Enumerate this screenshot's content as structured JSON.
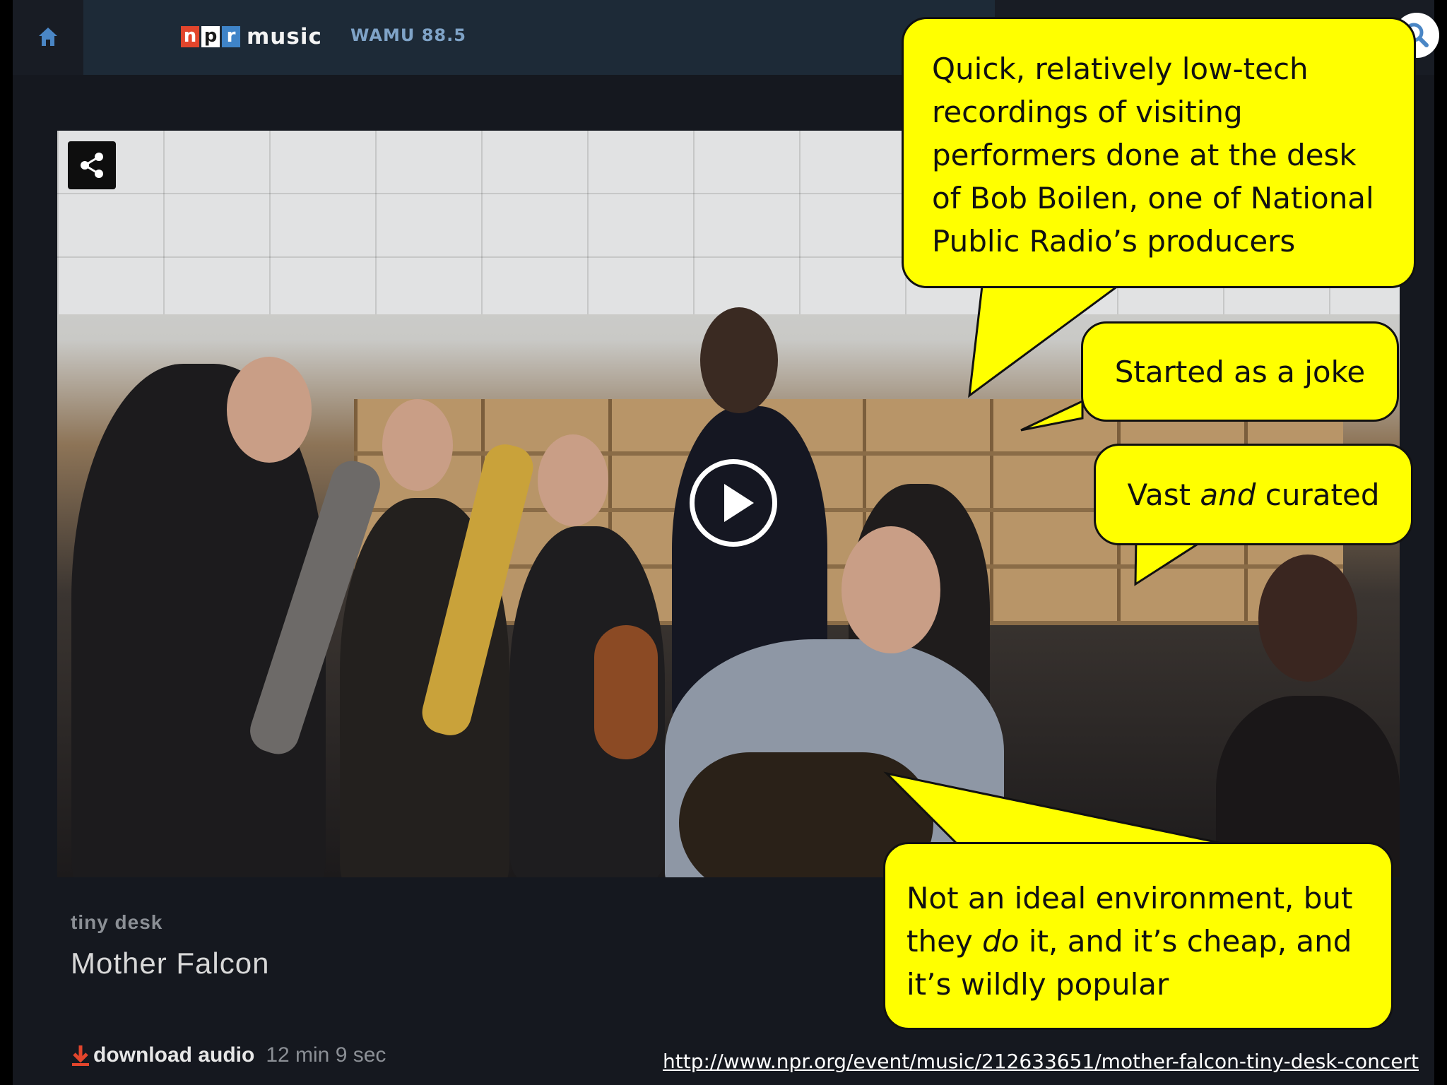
{
  "nav": {
    "logo_n": "n",
    "logo_p": "p",
    "logo_r": "r",
    "logo_music": "music",
    "station": "WAMU 88.5"
  },
  "video": {
    "section": "tiny desk",
    "title": "Mother Falcon"
  },
  "download": {
    "label": "download audio",
    "duration": "12 min 9 sec"
  },
  "callouts": [
    {
      "text": "Quick, relatively low-tech\nrecordings of visiting\nperformers done at the desk\nof Bob Boilen, one of National\nPublic Radio’s producers"
    },
    {
      "text": "Started as a joke"
    },
    {
      "pre": "Vast ",
      "em": "and",
      "post": " curated"
    },
    {
      "line1": "Not an ideal environment, but",
      "pre2": "they ",
      "em2": "do",
      "post2": " it, and it’s cheap, and",
      "line3": "it’s wildly popular"
    }
  ],
  "source_url": "http://www.npr.org/event/music/212633651/mother-falcon-tiny-desk-concert",
  "colors": {
    "callout_fill": "#ffff00",
    "npr_red": "#e2452c",
    "npr_blue": "#3f84c8",
    "station_blue": "#7fa3c7",
    "download_red": "#e2452c"
  }
}
